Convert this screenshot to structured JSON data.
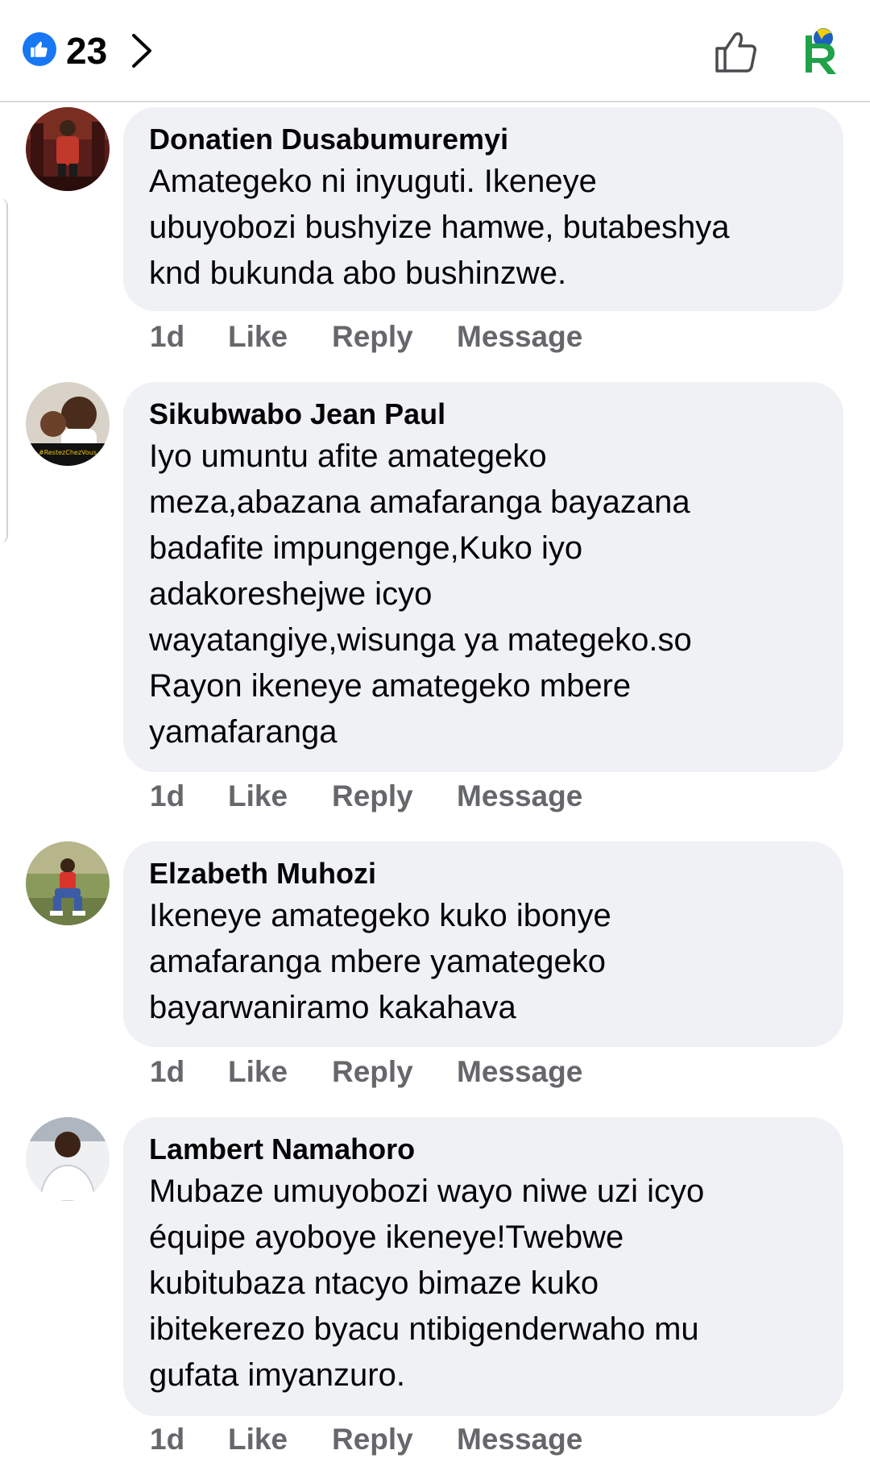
{
  "header": {
    "reaction_count": "23",
    "colors": {
      "like_blue": "#1877f2"
    },
    "icons": [
      "like-reaction-icon",
      "chevron-right-icon",
      "thumbs-up-icon",
      "rayon-sports-logo"
    ]
  },
  "comments": [
    {
      "author": "Donatien Dusabumuremyi",
      "lines": [
        "Amategeko ni inyuguti. Ikeneye",
        "ubuyobozi bushyize hamwe, butabeshya",
        "knd bukunda abo bushinzwe."
      ],
      "time": "1d",
      "like": "Like",
      "reply": "Reply",
      "message": "Message"
    },
    {
      "author": "Sikubwabo Jean Paul",
      "lines": [
        "Iyo umuntu afite amategeko",
        "meza,abazana amafaranga bayazana",
        "badafite impungenge,Kuko iyo",
        "adakoreshejwe icyo",
        "wayatangiye,wisunga ya mategeko.so",
        "Rayon ikeneye amategeko mbere",
        "yamafaranga"
      ],
      "avatar_caption": "#RestezChezVous",
      "time": "1d",
      "like": "Like",
      "reply": "Reply",
      "message": "Message"
    },
    {
      "author": "Elzabeth Muhozi",
      "lines": [
        "Ikeneye amategeko kuko ibonye",
        "amafaranga mbere yamategeko",
        "bayarwaniramo kakahava"
      ],
      "time": "1d",
      "like": "Like",
      "reply": "Reply",
      "message": "Message"
    },
    {
      "author": "Lambert Namahoro",
      "lines": [
        "Mubaze umuyobozi wayo niwe uzi icyo",
        "équipe ayoboye ikeneye!Twebwe",
        "kubitubaza ntacyo bimaze kuko",
        "ibitekerezo byacu ntibigenderwaho mu",
        "gufata imyanzuro."
      ],
      "time": "1d",
      "like": "Like",
      "reply": "Reply",
      "message": "Message"
    }
  ]
}
